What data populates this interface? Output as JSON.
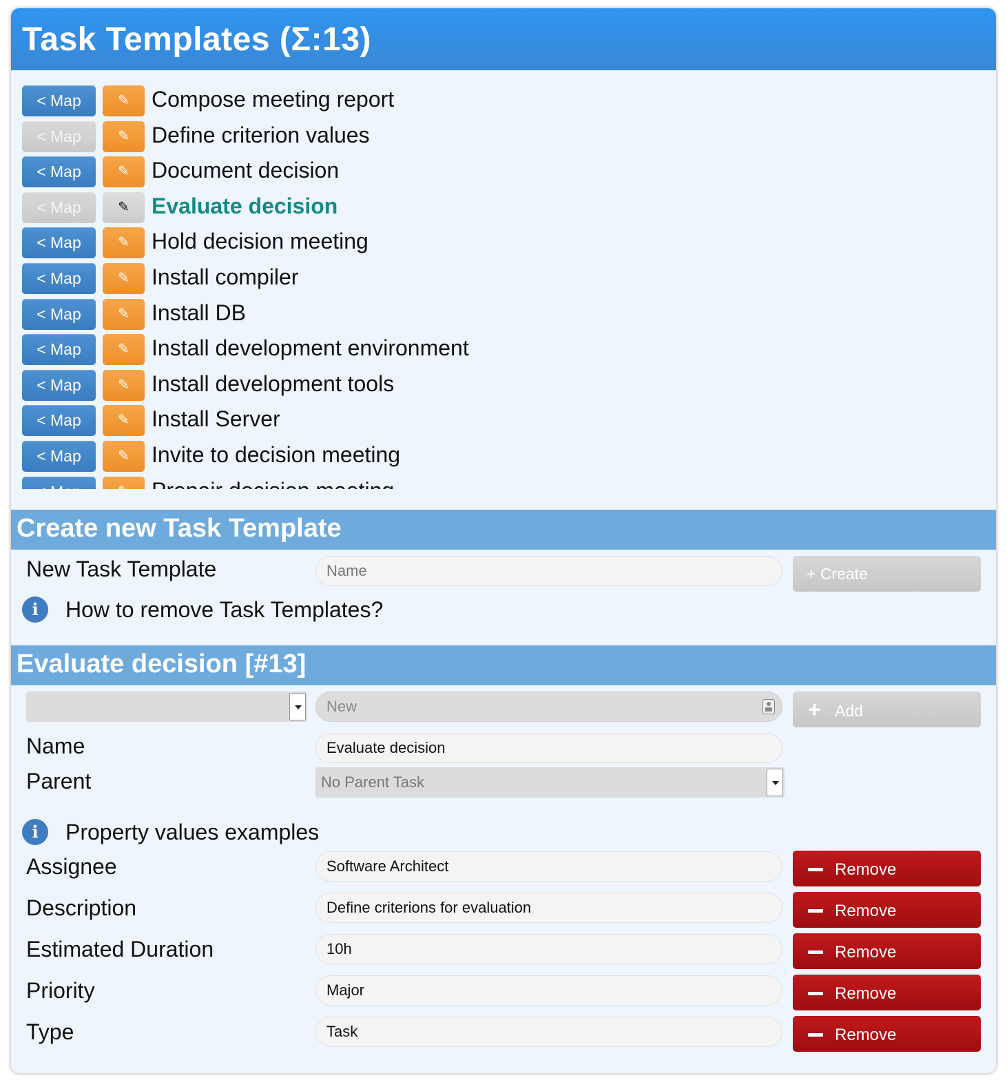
{
  "header": {
    "title": "Task Templates (Σ:13)"
  },
  "templates": {
    "map_label": "< Map",
    "edit_icon": "pencil-icon",
    "items": [
      {
        "label": "Compose meeting report",
        "map_enabled": true,
        "selected": false
      },
      {
        "label": "Define criterion values",
        "map_enabled": false,
        "selected": false
      },
      {
        "label": "Document decision",
        "map_enabled": true,
        "selected": false
      },
      {
        "label": "Evaluate decision",
        "map_enabled": false,
        "selected": true
      },
      {
        "label": "Hold decision meeting",
        "map_enabled": true,
        "selected": false
      },
      {
        "label": "Install compiler",
        "map_enabled": true,
        "selected": false
      },
      {
        "label": "Install DB",
        "map_enabled": true,
        "selected": false
      },
      {
        "label": "Install development environment",
        "map_enabled": true,
        "selected": false
      },
      {
        "label": "Install development tools",
        "map_enabled": true,
        "selected": false
      },
      {
        "label": "Install Server",
        "map_enabled": true,
        "selected": false
      },
      {
        "label": "Invite to decision meeting",
        "map_enabled": true,
        "selected": false
      },
      {
        "label": "Prepair decision meeting",
        "map_enabled": true,
        "selected": false
      }
    ]
  },
  "create": {
    "heading": "Create new Task Template",
    "label": "New Task Template",
    "name_placeholder": "Name",
    "create_button": "+ Create",
    "help": "How to remove Task Templates?"
  },
  "details": {
    "heading": "Evaluate decision [#13]",
    "new_placeholder": "New",
    "add_button": "Add",
    "name_label": "Name",
    "name_value": "Evaluate decision",
    "parent_label": "Parent",
    "parent_value": "No Parent Task",
    "examples_help": "Property values examples",
    "remove_label": "Remove",
    "properties": [
      {
        "label": "Assignee",
        "value": "Software Architect"
      },
      {
        "label": "Description",
        "value": "Define criterions for evaluation"
      },
      {
        "label": "Estimated Duration",
        "value": "10h"
      },
      {
        "label": "Priority",
        "value": "Major"
      },
      {
        "label": "Type",
        "value": "Task"
      }
    ]
  },
  "colors": {
    "title_bar": "#2f94f0",
    "section_header": "#6faadd",
    "map_button": "#4e92d3",
    "edit_button": "#f19a36",
    "selected_text": "#158a85",
    "remove_button": "#b01417"
  }
}
